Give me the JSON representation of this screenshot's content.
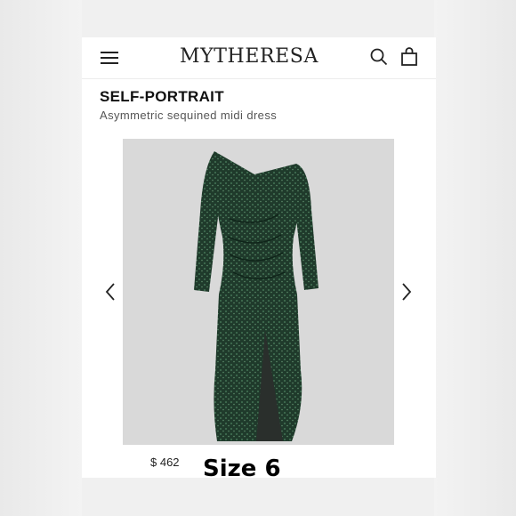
{
  "header": {
    "brand": "MYTHERESA",
    "menu_icon": "hamburger-icon",
    "search_icon": "search-icon",
    "bag_icon": "shopping-bag-icon"
  },
  "product": {
    "designer": "SELF-PORTRAIT",
    "name": "Asymmetric sequined midi dress",
    "price": "$ 462",
    "dress_color": "#1f3a2b",
    "background_color": "#d9d9d9"
  },
  "carousel": {
    "prev_icon": "chevron-left-icon",
    "next_icon": "chevron-right-icon"
  },
  "overlay": {
    "size_text": "Size 6"
  }
}
